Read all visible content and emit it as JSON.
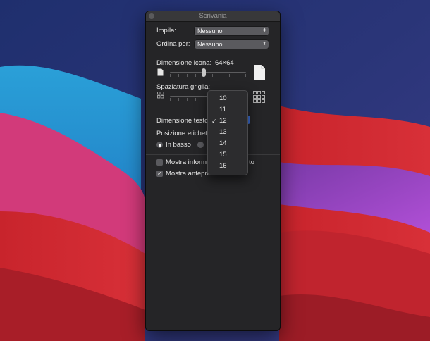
{
  "window": {
    "title": "Scrivania"
  },
  "stack_by": {
    "label": "Impila:",
    "value": "Nessuno"
  },
  "sort_by": {
    "label": "Ordina per:",
    "value": "Nessuno"
  },
  "icon_size": {
    "label": "Dimensione icona:",
    "value": "64×64",
    "slider_fraction": 0.44
  },
  "grid_spacing": {
    "label": "Spaziatura griglia:"
  },
  "text_size": {
    "label": "Dimensione testo",
    "selected": "12"
  },
  "label_position": {
    "label": "Posizione etichet",
    "options": [
      {
        "label": "In basso",
        "selected": true
      },
      {
        "label": "A",
        "selected": false
      }
    ]
  },
  "checkboxes": [
    {
      "label": "Mostra inform",
      "label_tail": "to",
      "checked": false
    },
    {
      "label": "Mostra anteprima icona",
      "checked": true
    }
  ],
  "dropdown": {
    "options": [
      "10",
      "11",
      "12",
      "13",
      "14",
      "15",
      "16"
    ],
    "selected": "12"
  },
  "colors": {
    "panel": "#252527",
    "accent": "#3b6fd8"
  }
}
